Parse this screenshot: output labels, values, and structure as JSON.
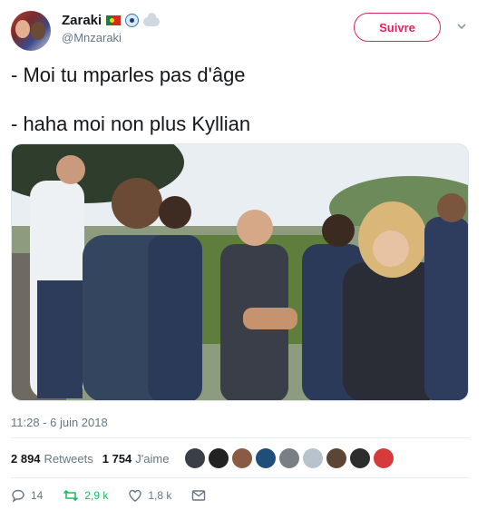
{
  "user": {
    "display_name": "Zaraki",
    "handle": "@Mnzaraki",
    "emoji_icons": [
      "portugal-flag-icon",
      "eye-icon",
      "cloud-icon"
    ]
  },
  "follow_label": "Suivre",
  "tweet": {
    "line1": "- Moi tu mparles pas d'âge",
    "line2": "- haha moi non plus Kyllian"
  },
  "timestamp": "11:28 - 6 juin 2018",
  "stats": {
    "retweets_count": "2 894",
    "retweets_label": "Retweets",
    "likes_count": "1 754",
    "likes_label": "J'aime"
  },
  "likers_colors": [
    "#3a3f45",
    "#222222",
    "#8a5a44",
    "#1f4e79",
    "#7a7f86",
    "#b8c2cc",
    "#5b4636",
    "#2d2d2d",
    "#d63a3a"
  ],
  "actions": {
    "reply_count": "14",
    "retweet_count": "2,9 k",
    "like_count": "1,8 k"
  },
  "colors": {
    "accent_pink": "#e0245e",
    "retweet_green": "#17bf63",
    "muted": "#657786"
  }
}
